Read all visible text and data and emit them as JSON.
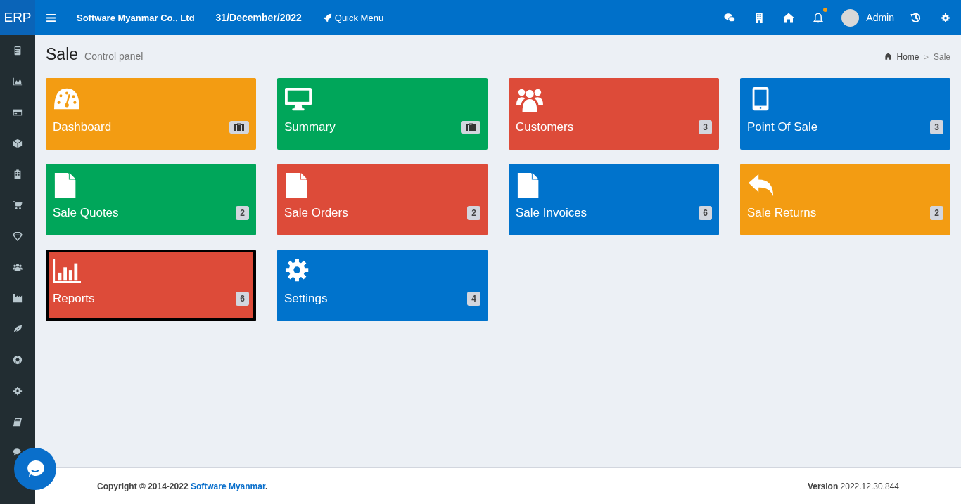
{
  "app": {
    "logo": "ERP"
  },
  "topbar": {
    "company": "Software Myanmar Co., Ltd",
    "date": "31/December/2022",
    "quick_menu": "Quick Menu",
    "has_notification": true,
    "user": "Admin"
  },
  "sidebar": {
    "items": [
      {
        "kind": "calculator"
      },
      {
        "kind": "area-chart"
      },
      {
        "kind": "card"
      },
      {
        "kind": "cube"
      },
      {
        "kind": "building"
      },
      {
        "kind": "cart"
      },
      {
        "kind": "diamond"
      },
      {
        "kind": "users"
      },
      {
        "kind": "factory"
      },
      {
        "kind": "leaf"
      },
      {
        "kind": "ball"
      },
      {
        "kind": "gear"
      },
      {
        "kind": "book"
      },
      {
        "kind": "comments"
      }
    ]
  },
  "page": {
    "title": "Sale",
    "subtitle": "Control panel"
  },
  "breadcrumb": [
    "Home",
    "Sale"
  ],
  "breadcrumb_separator": ">",
  "tiles": [
    {
      "label": "Dashboard",
      "color": "#f39c12",
      "kind": "gauge",
      "badge": {
        "kind": "briefcase"
      },
      "selected": false
    },
    {
      "label": "Summary",
      "color": "#00a65a",
      "kind": "monitor",
      "badge": {
        "kind": "briefcase"
      },
      "selected": false
    },
    {
      "label": "Customers",
      "color": "#dd4b39",
      "kind": "users",
      "badge": {
        "kind": "count",
        "text": "3"
      },
      "selected": false
    },
    {
      "label": "Point Of Sale",
      "color": "#0073cc",
      "kind": "tablet",
      "badge": {
        "kind": "count",
        "text": "3"
      },
      "selected": false
    },
    {
      "label": "Sale Quotes",
      "color": "#00a65a",
      "kind": "file",
      "badge": {
        "kind": "count",
        "text": "2"
      },
      "selected": false
    },
    {
      "label": "Sale Orders",
      "color": "#dd4b39",
      "kind": "file",
      "badge": {
        "kind": "count",
        "text": "2"
      },
      "selected": false
    },
    {
      "label": "Sale Invoices",
      "color": "#0073cc",
      "kind": "file",
      "badge": {
        "kind": "count",
        "text": "6"
      },
      "selected": false
    },
    {
      "label": "Sale Returns",
      "color": "#f39c12",
      "kind": "reply",
      "badge": {
        "kind": "count",
        "text": "2"
      },
      "selected": false
    },
    {
      "label": "Reports",
      "color": "#dd4b39",
      "kind": "bar-chart",
      "badge": {
        "kind": "count",
        "text": "6"
      },
      "selected": true
    },
    {
      "label": "Settings",
      "color": "#0073cc",
      "kind": "gear",
      "badge": {
        "kind": "count",
        "text": "4"
      },
      "selected": false
    }
  ],
  "footer": {
    "copyright": "Copyright © 2014-2022",
    "company_link": "Software Myanmar",
    "suffix": ".",
    "version_label": "Version",
    "version": "2022.12.30.844"
  }
}
